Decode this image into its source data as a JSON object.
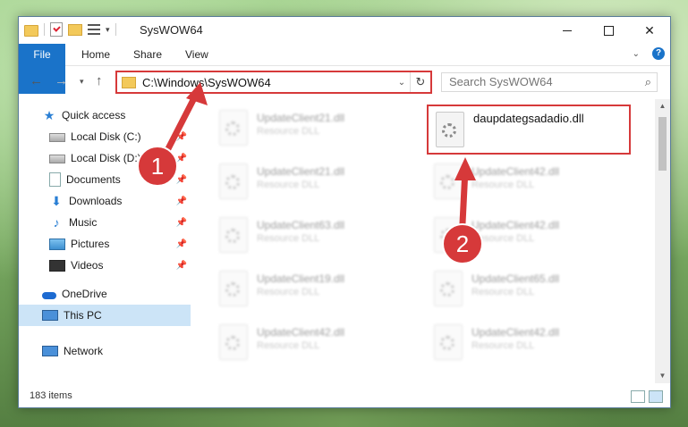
{
  "window": {
    "title": "SysWOW64",
    "controls": {
      "minimize": "minimize",
      "maximize": "maximize",
      "close": "✕"
    }
  },
  "ribbon": {
    "tabs": [
      {
        "label": "File"
      },
      {
        "label": "Home"
      },
      {
        "label": "Share"
      },
      {
        "label": "View"
      }
    ],
    "help": "?"
  },
  "address": {
    "path": "C:\\Windows\\SysWOW64",
    "search_placeholder": "Search SysWOW64"
  },
  "sidebar": {
    "items": [
      {
        "label": "Quick access",
        "icon": "star-icon"
      },
      {
        "label": "Local Disk (C:)",
        "icon": "disk-icon",
        "pinned": true
      },
      {
        "label": "Local Disk (D:)",
        "icon": "disk-icon",
        "pinned": true
      },
      {
        "label": "Documents",
        "icon": "documents-icon",
        "pinned": true
      },
      {
        "label": "Downloads",
        "icon": "downloads-icon",
        "pinned": true
      },
      {
        "label": "Music",
        "icon": "music-icon",
        "pinned": true
      },
      {
        "label": "Pictures",
        "icon": "pictures-icon",
        "pinned": true
      },
      {
        "label": "Videos",
        "icon": "videos-icon",
        "pinned": true
      },
      {
        "label": "OneDrive",
        "icon": "onedrive-icon"
      },
      {
        "label": "This PC",
        "icon": "this-pc-icon",
        "selected": true
      },
      {
        "label": "Network",
        "icon": "network-icon"
      }
    ]
  },
  "files": {
    "left_column": [
      {
        "name": "UpdateClient21.dll",
        "type": "Resource DLL"
      },
      {
        "name": "UpdateClient21.dll",
        "type": "Resource DLL"
      },
      {
        "name": "UpdateClient63.dll",
        "type": "Resource DLL"
      },
      {
        "name": "UpdateClient19.dll",
        "type": "Resource DLL"
      },
      {
        "name": "UpdateClient42.dll",
        "type": "Resource DLL"
      }
    ],
    "right_column": [
      {
        "name": "daupdategsadadio.dll",
        "type": "",
        "highlighted": true
      },
      {
        "name": "UpdateClient42.dll",
        "type": "Resource DLL"
      },
      {
        "name": "UpdateClient42.dll",
        "type": "Resource DLL"
      },
      {
        "name": "UpdateClient65.dll",
        "type": "Resource DLL"
      },
      {
        "name": "UpdateClient42.dll",
        "type": "Resource DLL"
      }
    ]
  },
  "status": {
    "item_count": "183 items"
  },
  "annotations": {
    "step1": "1",
    "step2": "2",
    "color": "#d6393a"
  }
}
